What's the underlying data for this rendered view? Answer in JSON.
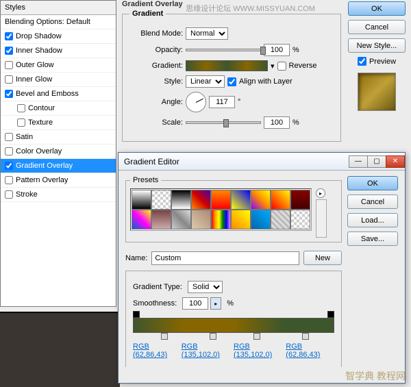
{
  "styles_panel": {
    "header": "Styles",
    "blending": "Blending Options: Default",
    "items": [
      {
        "label": "Drop Shadow",
        "checked": true,
        "sub": false,
        "sel": false
      },
      {
        "label": "Inner Shadow",
        "checked": true,
        "sub": false,
        "sel": false
      },
      {
        "label": "Outer Glow",
        "checked": false,
        "sub": false,
        "sel": false
      },
      {
        "label": "Inner Glow",
        "checked": false,
        "sub": false,
        "sel": false
      },
      {
        "label": "Bevel and Emboss",
        "checked": true,
        "sub": false,
        "sel": false
      },
      {
        "label": "Contour",
        "checked": false,
        "sub": true,
        "sel": false
      },
      {
        "label": "Texture",
        "checked": false,
        "sub": true,
        "sel": false
      },
      {
        "label": "Satin",
        "checked": false,
        "sub": false,
        "sel": false
      },
      {
        "label": "Color Overlay",
        "checked": false,
        "sub": false,
        "sel": false
      },
      {
        "label": "Gradient Overlay",
        "checked": true,
        "sub": false,
        "sel": true
      },
      {
        "label": "Pattern Overlay",
        "checked": false,
        "sub": false,
        "sel": false
      },
      {
        "label": "Stroke",
        "checked": false,
        "sub": false,
        "sel": false
      }
    ]
  },
  "overlay": {
    "title": "Gradient Overlay",
    "legend": "Gradient",
    "blend_label": "Blend Mode:",
    "blend_value": "Normal",
    "opacity_label": "Opacity:",
    "opacity_value": "100",
    "opacity_unit": "%",
    "gradient_label": "Gradient:",
    "reverse_label": "Reverse",
    "style_label": "Style:",
    "style_value": "Linear",
    "align_label": "Align with Layer",
    "angle_label": "Angle:",
    "angle_value": "117",
    "angle_unit": "°",
    "scale_label": "Scale:",
    "scale_value": "100",
    "scale_unit": "%"
  },
  "rbtns": {
    "ok": "OK",
    "cancel": "Cancel",
    "newstyle": "New Style...",
    "preview": "Preview"
  },
  "ged": {
    "title": "Gradient Editor",
    "presets_legend": "Presets",
    "name_label": "Name:",
    "name_value": "Custom",
    "new_btn": "New",
    "ok": "OK",
    "cancel": "Cancel",
    "load": "Load...",
    "save": "Save...",
    "gtype_label": "Gradient Type:",
    "gtype_value": "Solid",
    "smooth_label": "Smoothness:",
    "smooth_value": "100",
    "smooth_unit": "%",
    "stop_labels": [
      "RGB (62,86,43)",
      "RGB (135,102,0)",
      "RGB (135,102,0)",
      "RGB (62,86,43)"
    ]
  },
  "presets_bg": [
    "linear-gradient(#fff,#000)",
    "repeating-conic-gradient(#ccc 0 25%,#fff 0 50%) 0/8px 8px",
    "linear-gradient(#000,#fff)",
    "linear-gradient(45deg,#f80,#c00,#40a)",
    "linear-gradient(#f80,#f00)",
    "linear-gradient(45deg,#ff0,#00f)",
    "linear-gradient(45deg,#80f,#f80,#ff0)",
    "linear-gradient(45deg,#f00,#ff0)",
    "linear-gradient(#800,#400)",
    "linear-gradient(45deg,#06c,#f0f,#ff0)",
    "linear-gradient(#744,#caa)",
    "linear-gradient(45deg,#ccc,#888,#ddd)",
    "linear-gradient(45deg,#dca,#a87)",
    "linear-gradient(to right,red,orange,yellow,green,blue,violet)",
    "linear-gradient(45deg,#f80,#ff0)",
    "linear-gradient(45deg,#06a,#0af)",
    "repeating-linear-gradient(45deg,#bbb 0 3px,#ddd 3px 6px)",
    "repeating-conic-gradient(#ccc 0 25%,#fff 0 50%) 0/8px 8px"
  ],
  "wm1": "思缘设计论坛   WWW.MISSYUAN.COM",
  "wm2": "智学典 教程网"
}
